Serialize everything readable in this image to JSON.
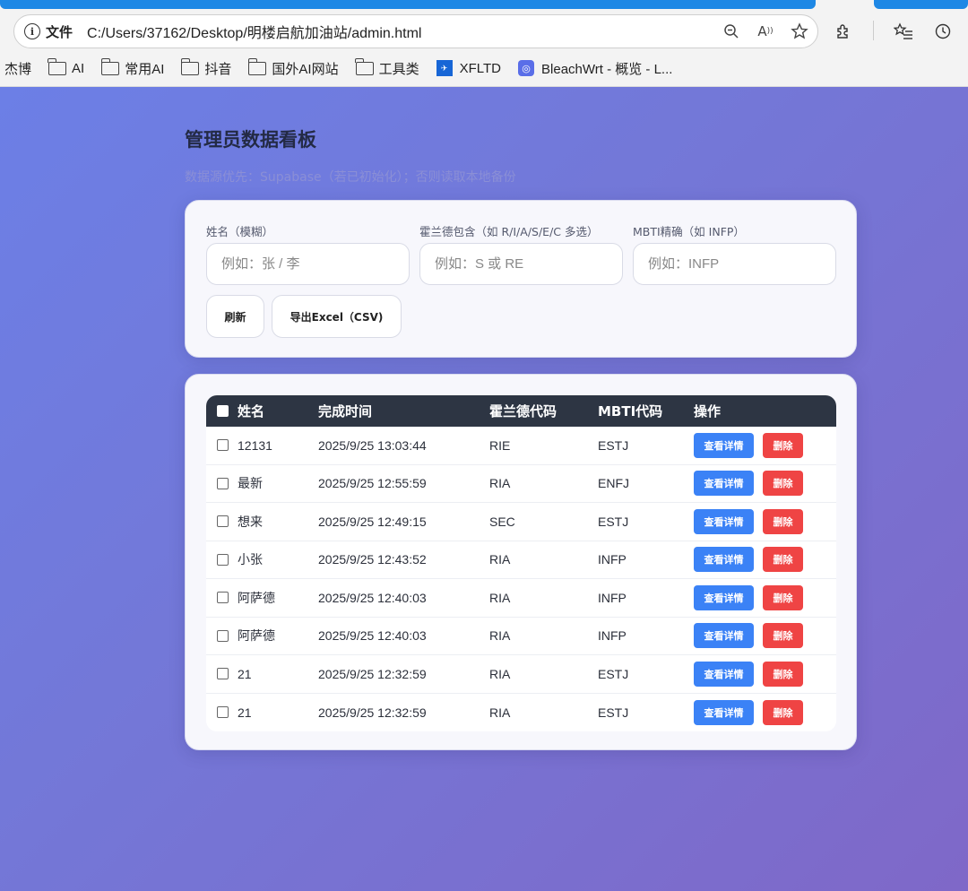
{
  "browser": {
    "scheme_label": "文件",
    "url": "C:/Users/37162/Desktop/明楼启航加油站/admin.html",
    "bookmarks": [
      {
        "label": "杰博",
        "type": "text"
      },
      {
        "label": "AI",
        "type": "folder"
      },
      {
        "label": "常用AI",
        "type": "folder"
      },
      {
        "label": "抖音",
        "type": "folder"
      },
      {
        "label": "国外AI网站",
        "type": "folder"
      },
      {
        "label": "工具类",
        "type": "folder"
      },
      {
        "label": "XFLTD",
        "type": "favicon"
      },
      {
        "label": "BleachWrt - 概览 - L...",
        "type": "favicon"
      }
    ],
    "accent": "#1e88e5"
  },
  "page": {
    "title": "管理员数据看板",
    "subtitle": "数据源优先：Supabase（若已初始化）；否则读取本地备份"
  },
  "filters": {
    "name_label": "姓名（模糊）",
    "name_placeholder": "例如：张 / 李",
    "holland_label": "霍兰德包含（如 R/I/A/S/E/C 多选）",
    "holland_placeholder": "例如：S 或 RE",
    "mbti_label": "MBTI精确（如 INFP）",
    "mbti_placeholder": "例如：INFP",
    "refresh_label": "刷新",
    "export_label": "导出Excel（CSV)"
  },
  "table": {
    "headers": {
      "name": "姓名",
      "time": "完成时间",
      "holland": "霍兰德代码",
      "mbti": "MBTI代码",
      "actions": "操作"
    },
    "view_label": "查看详情",
    "delete_label": "删除",
    "rows": [
      {
        "name": "12131",
        "time": "2025/9/25 13:03:44",
        "holland": "RIE",
        "mbti": "ESTJ"
      },
      {
        "name": "最新",
        "time": "2025/9/25 12:55:59",
        "holland": "RIA",
        "mbti": "ENFJ"
      },
      {
        "name": "想来",
        "time": "2025/9/25 12:49:15",
        "holland": "SEC",
        "mbti": "ESTJ"
      },
      {
        "name": "小张",
        "time": "2025/9/25 12:43:52",
        "holland": "RIA",
        "mbti": "INFP"
      },
      {
        "name": "阿萨德",
        "time": "2025/9/25 12:40:03",
        "holland": "RIA",
        "mbti": "INFP"
      },
      {
        "name": "阿萨德",
        "time": "2025/9/25 12:40:03",
        "holland": "RIA",
        "mbti": "INFP"
      },
      {
        "name": "21",
        "time": "2025/9/25 12:32:59",
        "holland": "RIA",
        "mbti": "ESTJ"
      },
      {
        "name": "21",
        "time": "2025/9/25 12:32:59",
        "holland": "RIA",
        "mbti": "ESTJ"
      }
    ]
  },
  "colors": {
    "header_bg": "#2d3543",
    "view_button": "#3b82f6",
    "delete_button": "#ef4444"
  }
}
